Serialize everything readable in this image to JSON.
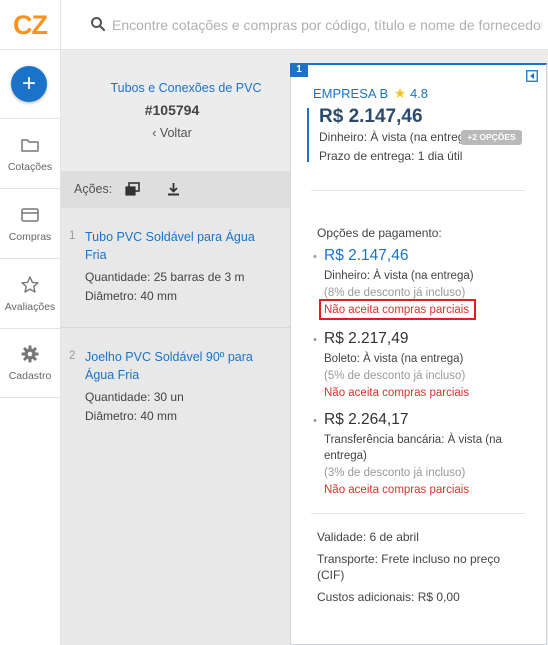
{
  "app": {
    "logo_text": "CZ",
    "brand_color": "#f7931e",
    "accent": "#1a73c9"
  },
  "search": {
    "placeholder": "Encontre cotações e compras por código, título e nome de fornecedor",
    "icon": "search-icon"
  },
  "sidebar": {
    "add_label": "+",
    "items": [
      {
        "label": "Cotações",
        "icon": "folder-icon"
      },
      {
        "label": "Compras",
        "icon": "card-icon"
      },
      {
        "label": "Avaliações",
        "icon": "star-icon"
      },
      {
        "label": "Cadastro",
        "icon": "gear-icon"
      }
    ]
  },
  "quote": {
    "title": "Tubos e Conexões de PVC",
    "code": "#105794",
    "back_label": "‹ Voltar",
    "actions_label": "Ações:",
    "items": [
      {
        "number": "1",
        "title": "Tubo PVC Soldável para Água Fria",
        "quantity_label": "Quantidade:",
        "quantity": "25 barras de 3 m",
        "diameter_label": "Diâmetro:",
        "diameter": "40 mm"
      },
      {
        "number": "2",
        "title": "Joelho PVC Soldável 90º para Água Fria",
        "quantity_label": "Quantidade:",
        "quantity": "30 un",
        "diameter_label": "Diâmetro:",
        "diameter": "40 mm"
      }
    ]
  },
  "proposal": {
    "badge": "1",
    "supplier": "EMPRESA B",
    "rating": "4.8",
    "price": "R$ 2.147,46",
    "payment_label": "Dinheiro:",
    "payment_value": "À vista (na entrega)",
    "more_options": "+2 OPÇÕES",
    "delivery_label": "Prazo de entrega:",
    "delivery_value": "1 dia útil",
    "payment_options_title": "Opções de pagamento:",
    "options": [
      {
        "price": "R$ 2.147,46",
        "method": "Dinheiro: À vista (na entrega)",
        "discount": "(8% de desconto já incluso)",
        "partial": "Não aceita compras parciais"
      },
      {
        "price": "R$ 2.217,49",
        "method": "Boleto: À vista (na entrega)",
        "discount": "(5% de desconto já incluso)",
        "partial": "Não aceita compras parciais"
      },
      {
        "price": "R$ 2.264,17",
        "method_1": "Transferência bancária: À vista (na",
        "method_2": "entrega)",
        "discount": "(3% de desconto já incluso)",
        "partial": "Não aceita compras parciais"
      }
    ],
    "validity_label": "Validade:",
    "validity_value": "6 de abril",
    "transport_label": "Transporte:",
    "transport_value_1": "Frete incluso no preço",
    "transport_value_2": "(CIF)",
    "additional_label": "Custos adicionais:",
    "additional_value": "R$ 0,00"
  }
}
